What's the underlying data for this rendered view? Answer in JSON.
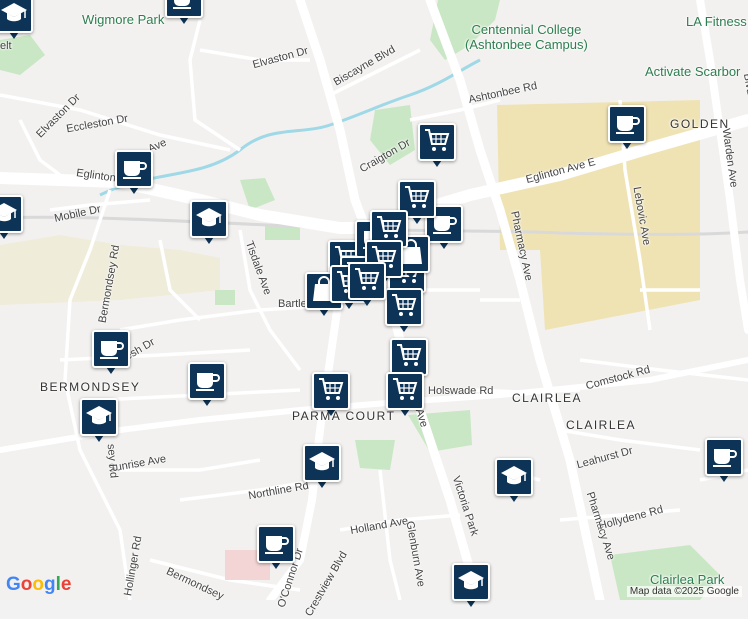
{
  "labels": {
    "parks": [
      "Wigmore Park",
      "Centennial College\n(Ashtonbee Campus)",
      "LA Fitness",
      "Activate Scarbor",
      "Clairlea Park"
    ],
    "neighbourhoods": [
      "BERMONDSEY",
      "PARMA COURT",
      "CLAIRLEA",
      "CLAIRLEA",
      "GOLDEN"
    ],
    "streets": [
      "Elvaston Dr",
      "Biscayne Blvd",
      "Ashtonbee Rd",
      "Eccleston Dr",
      "Ave",
      "Craigton Dr",
      "Eglinton Ave E",
      "Eglinton Ave E",
      "Mobile Dr",
      "Bermondsey Rd",
      "Tisdale Ave",
      "Bartley",
      "Pharmacy Ave",
      "Lebovic Ave",
      "Warden Ave",
      "Holswade Rd",
      "Comstock Rd",
      "Lesh Dr",
      "Sunrise Ave",
      "Northline Rd",
      "Victoria Park",
      "Ave",
      "Holland Ave",
      "Glenburn Ave",
      "Hollinger Rd",
      "Bermondsey",
      "O'Connor Dr",
      "Crestview Blvd",
      "Pharmacy Ave",
      "Leahurst Dr",
      "Hollydene Rd",
      "Blvd",
      "sey Rd",
      "Elvaston Dr",
      "elt"
    ]
  },
  "markers": [
    {
      "icon": "coffee-icon"
    },
    {
      "icon": "school-icon"
    },
    {
      "icon": "school-icon"
    },
    {
      "icon": "coffee-icon"
    },
    {
      "icon": "coffee-icon"
    },
    {
      "icon": "coffee-icon"
    },
    {
      "icon": "school-icon"
    },
    {
      "icon": "coffee-icon"
    },
    {
      "icon": "school-icon"
    },
    {
      "icon": "school-icon"
    },
    {
      "icon": "school-icon"
    },
    {
      "icon": "shopping-cart-icon"
    },
    {
      "icon": "shopping-cart-icon"
    },
    {
      "icon": "shopping-cart-icon"
    },
    {
      "icon": "coffee-icon"
    },
    {
      "icon": "shopping-bag-icon"
    },
    {
      "icon": "shopping-cart-icon"
    },
    {
      "icon": "shopping-cart-icon"
    },
    {
      "icon": "shopping-cart-icon"
    },
    {
      "icon": "shopping-bag-icon"
    },
    {
      "icon": "shopping-cart-icon"
    },
    {
      "icon": "shopping-cart-icon"
    },
    {
      "icon": "shopping-cart-icon"
    },
    {
      "icon": "shopping-cart-icon"
    },
    {
      "icon": "coffee-icon"
    },
    {
      "icon": "coffee-icon"
    },
    {
      "icon": "school-icon"
    },
    {
      "icon": "coffee-icon"
    },
    {
      "icon": "shopping-cart-icon"
    },
    {
      "icon": "shopping-cart-icon"
    },
    {
      "icon": "shopping-cart-icon"
    }
  ],
  "attribution": "Map data ©2025 Google",
  "logo": "Google",
  "colors": {
    "marker": "#0d3457",
    "park": "#c9e7c4",
    "institution": "#efe3b4",
    "road": "#ffffff"
  }
}
